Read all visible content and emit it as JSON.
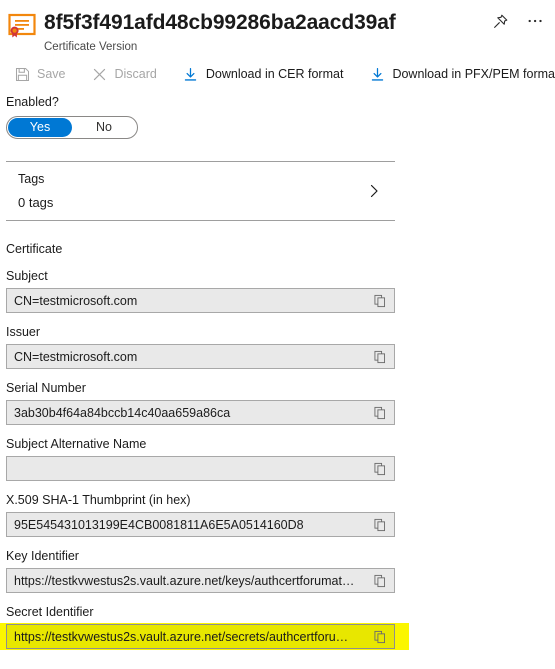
{
  "header": {
    "icon": "certificate-icon",
    "title": "8f5f3f491afd48cb99286ba2aacd39af",
    "subtitle": "Certificate Version",
    "pin_icon": "pin-icon",
    "more_icon": "ellipsis-icon"
  },
  "toolbar": {
    "items": [
      {
        "label": "Save",
        "icon": "save-icon",
        "enabled": false
      },
      {
        "label": "Discard",
        "icon": "discard-x-icon",
        "enabled": false
      },
      {
        "label": "Download in CER format",
        "icon": "download-icon",
        "enabled": true
      },
      {
        "label": "Download in PFX/PEM format",
        "icon": "download-icon",
        "enabled": true
      }
    ]
  },
  "enabled": {
    "label": "Enabled?",
    "option_yes": "Yes",
    "option_no": "No",
    "selected": "Yes"
  },
  "tags": {
    "label": "Tags",
    "value": "0 tags",
    "chevron_icon": "chevron-right-icon"
  },
  "certificate": {
    "section_title": "Certificate",
    "fields": [
      {
        "label": "Subject",
        "value": "CN=testmicrosoft.com",
        "copy_icon": "copy-icon",
        "highlighted": false
      },
      {
        "label": "Issuer",
        "value": "CN=testmicrosoft.com",
        "copy_icon": "copy-icon",
        "highlighted": false
      },
      {
        "label": "Serial Number",
        "value": "3ab30b4f64a84bccb14c40aa659a86ca",
        "copy_icon": "copy-icon",
        "highlighted": false
      },
      {
        "label": "Subject Alternative Name",
        "value": "",
        "copy_icon": "copy-icon",
        "highlighted": false
      },
      {
        "label": "X.509 SHA-1 Thumbprint (in hex)",
        "value": "95E545431013199E4CB0081811A6E5A0514160D8",
        "copy_icon": "copy-icon",
        "highlighted": false
      },
      {
        "label": "Key Identifier",
        "value": "https://testkvwestus2s.vault.azure.net/keys/authcertforumat…",
        "copy_icon": "copy-icon",
        "highlighted": false
      },
      {
        "label": "Secret Identifier",
        "value": "https://testkvwestus2s.vault.azure.net/secrets/authcertforu…",
        "copy_icon": "copy-icon",
        "highlighted": true
      }
    ]
  },
  "colors": {
    "accent_blue": "#0078d4",
    "icon_orange": "#f2870d",
    "seal_red": "#d13438",
    "highlight_yellow": "#fbf600",
    "field_bg": "#e9e9e9",
    "disabled_text": "#a6a6a6"
  }
}
